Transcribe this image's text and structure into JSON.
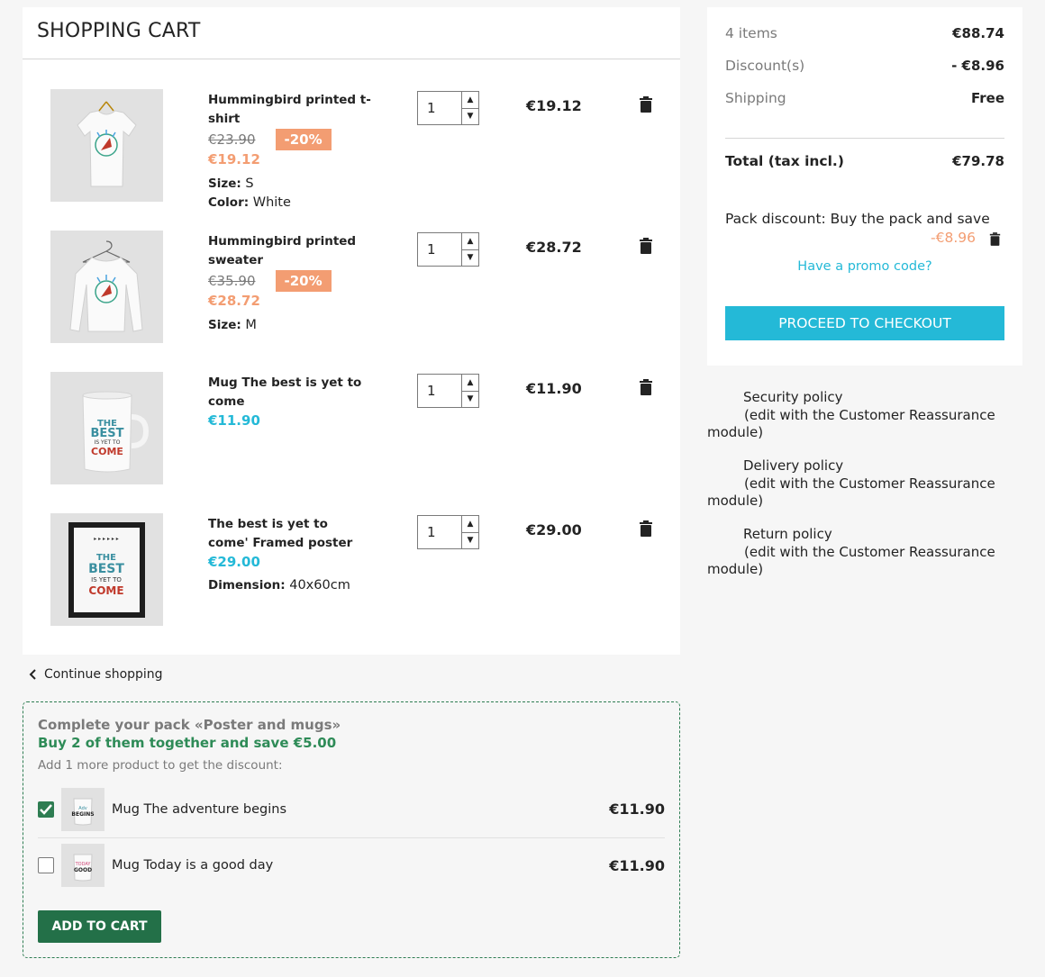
{
  "cart": {
    "title": "SHOPPING CART",
    "items": [
      {
        "name": "Hummingbird printed t-shirt",
        "old_price": "€23.90",
        "discount": "-20%",
        "price": "€19.12",
        "attrs": [
          {
            "label": "Size:",
            "value": "S"
          },
          {
            "label": "Color:",
            "value": "White"
          }
        ],
        "qty": "1",
        "total": "€19.12",
        "image": "tshirt"
      },
      {
        "name": "Hummingbird printed sweater",
        "old_price": "€35.90",
        "discount": "-20%",
        "price": "€28.72",
        "attrs": [
          {
            "label": "Size:",
            "value": "M"
          }
        ],
        "qty": "1",
        "total": "€28.72",
        "image": "sweater"
      },
      {
        "name": "Mug The best is yet to come",
        "price": "€11.90",
        "attrs": [],
        "qty": "1",
        "total": "€11.90",
        "image": "mug"
      },
      {
        "name": "The best is yet to come' Framed poster",
        "price": "€29.00",
        "attrs": [
          {
            "label": "Dimension:",
            "value": "40x60cm"
          }
        ],
        "qty": "1",
        "total": "€29.00",
        "image": "poster"
      }
    ],
    "continue_label": "Continue shopping"
  },
  "pack": {
    "title": "Complete your pack «Poster and mugs»",
    "save": "Buy 2 of them together and save €5.00",
    "hint": "Add 1 more product to get the discount:",
    "products": [
      {
        "name": "Mug The adventure begins",
        "price": "€11.90",
        "checked": true
      },
      {
        "name": "Mug Today is a good day",
        "price": "€11.90",
        "checked": false
      }
    ],
    "add_button": "ADD TO CART"
  },
  "summary": {
    "items_label": "4 items",
    "items_value": "€88.74",
    "discount_label": "Discount(s)",
    "discount_value": "- €8.96",
    "shipping_label": "Shipping",
    "shipping_value": "Free",
    "total_label": "Total (tax incl.)",
    "total_value": "€79.78",
    "pack_discount_label": "Pack discount: Buy the pack and save",
    "pack_discount_value": "-€8.96",
    "promo_link": "Have a promo code?",
    "checkout_button": "PROCEED TO CHECKOUT"
  },
  "reassurance": [
    {
      "title": "Security policy",
      "sub": "(edit with the Customer Reassurance",
      "sub2": "module)"
    },
    {
      "title": "Delivery policy",
      "sub": "(edit with the Customer Reassurance",
      "sub2": "module)"
    },
    {
      "title": "Return policy",
      "sub": "(edit with the Customer Reassurance",
      "sub2": "module)"
    }
  ],
  "colors": {
    "accent": "#24b9d7",
    "discount": "#f39d72",
    "pack_green": "#2e7d52"
  }
}
